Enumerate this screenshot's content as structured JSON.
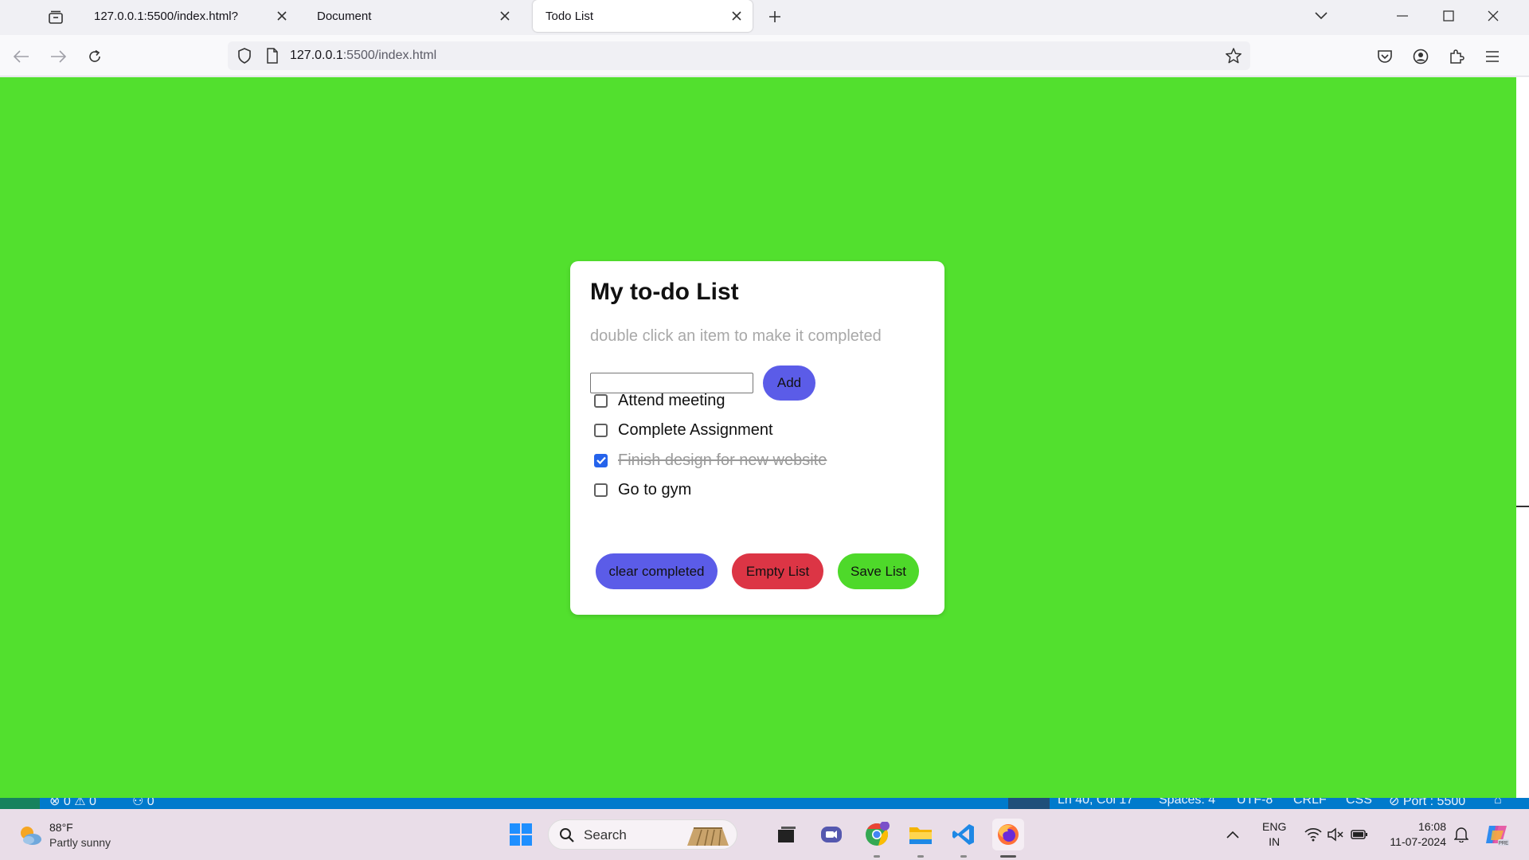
{
  "browser": {
    "tabs": [
      {
        "title": "127.0.0.1:5500/index.html?",
        "active": false
      },
      {
        "title": "Document",
        "active": false
      },
      {
        "title": "Todo List",
        "active": true
      }
    ],
    "url_host": "127.0.0.1",
    "url_rest": ":5500/index.html"
  },
  "app": {
    "background": "#52e02e",
    "title": "My to-do List",
    "hint": "double click an item to make it completed",
    "input_value": "",
    "add_label": "Add",
    "items": [
      {
        "text": "Attend meeting",
        "completed": false
      },
      {
        "text": "Complete Assignment",
        "completed": false
      },
      {
        "text": "Finish design for new website",
        "completed": true
      },
      {
        "text": "Go to gym",
        "completed": false
      }
    ],
    "clear_label": "clear completed",
    "empty_label": "Empty List",
    "save_label": "Save List",
    "colors": {
      "add": "#5b5ce8",
      "clear": "#5b5ce8",
      "empty": "#dc3545",
      "save": "#4ed92a"
    }
  },
  "vscode_status": {
    "problems": "0",
    "warnings": "0",
    "ports": "0",
    "position": "Ln 40, Col 17",
    "spaces": "Spaces: 4",
    "encoding": "UTF-8",
    "eol": "CRLF",
    "language": "CSS",
    "port": "Port : 5500"
  },
  "taskbar": {
    "weather_temp": "88°F",
    "weather_desc": "Partly sunny",
    "search_label": "Search",
    "lang_line1": "ENG",
    "lang_line2": "IN",
    "time": "16:08",
    "date": "11-07-2024"
  }
}
